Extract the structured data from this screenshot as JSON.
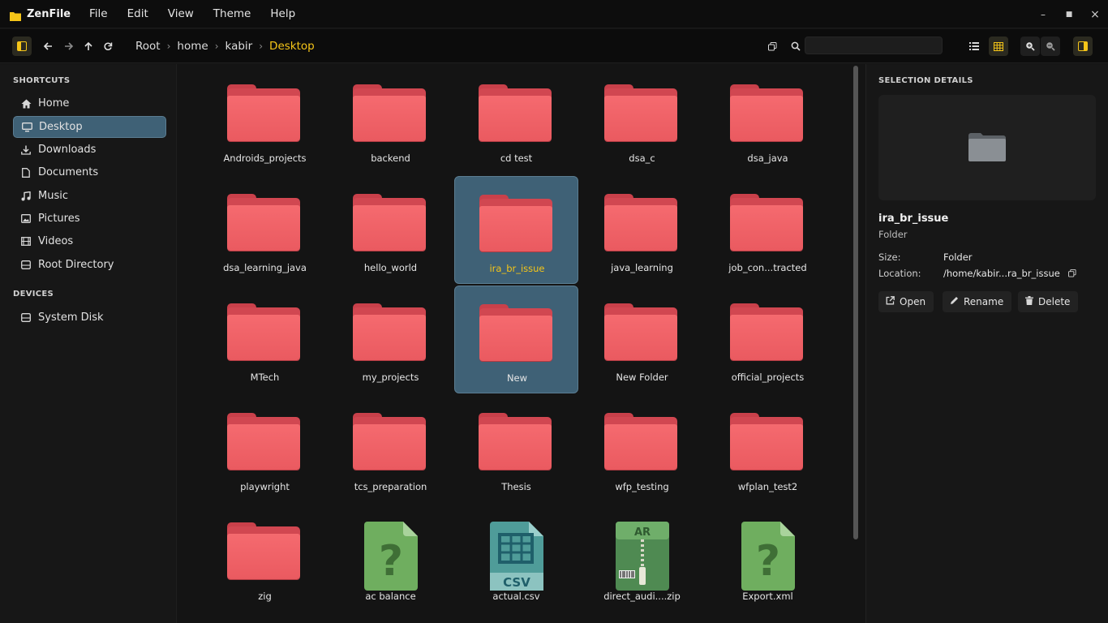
{
  "app": {
    "name": "ZenFile",
    "accent": "#f5c518"
  },
  "menu": [
    "File",
    "Edit",
    "View",
    "Theme",
    "Help"
  ],
  "window_controls": {
    "minimize": "–",
    "maximize": "■",
    "close": "×"
  },
  "toolbar": {
    "breadcrumbs": [
      "Root",
      "home",
      "kabir",
      "Desktop"
    ],
    "search_placeholder": ""
  },
  "sidebar": {
    "shortcuts_heading": "SHORTCUTS",
    "shortcuts": [
      {
        "label": "Home",
        "icon": "home-icon"
      },
      {
        "label": "Desktop",
        "icon": "desktop-icon",
        "selected": true
      },
      {
        "label": "Downloads",
        "icon": "download-icon"
      },
      {
        "label": "Documents",
        "icon": "document-icon"
      },
      {
        "label": "Music",
        "icon": "music-icon"
      },
      {
        "label": "Pictures",
        "icon": "picture-icon"
      },
      {
        "label": "Videos",
        "icon": "video-icon"
      },
      {
        "label": "Root Directory",
        "icon": "drive-icon"
      }
    ],
    "devices_heading": "DEVICES",
    "devices": [
      {
        "label": "System Disk",
        "icon": "disk-icon"
      }
    ]
  },
  "files": [
    {
      "name": "Androids_projects",
      "type": "folder"
    },
    {
      "name": "backend",
      "type": "folder"
    },
    {
      "name": "cd test",
      "type": "folder"
    },
    {
      "name": "dsa_c",
      "type": "folder"
    },
    {
      "name": "dsa_java",
      "type": "folder"
    },
    {
      "name": "dsa_learning_java",
      "type": "folder"
    },
    {
      "name": "hello_world",
      "type": "folder"
    },
    {
      "name": "ira_br_issue",
      "type": "folder",
      "selected": true
    },
    {
      "name": "java_learning",
      "type": "folder"
    },
    {
      "name": "job_con...tracted",
      "type": "folder"
    },
    {
      "name": "MTech",
      "type": "folder"
    },
    {
      "name": "my_projects",
      "type": "folder"
    },
    {
      "name": "New",
      "type": "folder",
      "selected": true
    },
    {
      "name": "New Folder",
      "type": "folder"
    },
    {
      "name": "official_projects",
      "type": "folder"
    },
    {
      "name": "playwright",
      "type": "folder"
    },
    {
      "name": "tcs_preparation",
      "type": "folder"
    },
    {
      "name": "Thesis",
      "type": "folder"
    },
    {
      "name": "wfp_testing",
      "type": "folder"
    },
    {
      "name": "wfplan_test2",
      "type": "folder"
    },
    {
      "name": "zig",
      "type": "folder"
    },
    {
      "name": "ac balance",
      "type": "unknown"
    },
    {
      "name": "actual.csv",
      "type": "csv",
      "badge": "CSV"
    },
    {
      "name": "direct_audi....zip",
      "type": "archive",
      "badge": "AR"
    },
    {
      "name": "Export.xml",
      "type": "unknown"
    }
  ],
  "details": {
    "heading": "SELECTION DETAILS",
    "name": "ira_br_issue",
    "type": "Folder",
    "size_label": "Size:",
    "size_value": "Folder",
    "location_label": "Location:",
    "location_value": "/home/kabir...ra_br_issue",
    "actions": {
      "open": "Open",
      "rename": "Rename",
      "delete": "Delete"
    }
  }
}
